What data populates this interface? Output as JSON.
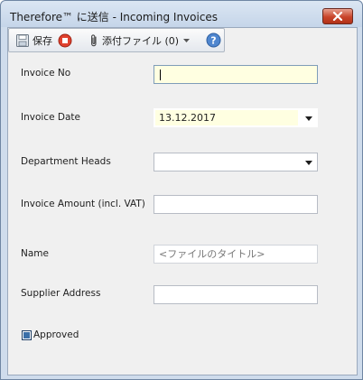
{
  "window": {
    "title": "Therefore™ に送信 - Incoming Invoices",
    "close_icon": "close-x-icon"
  },
  "toolbar": {
    "save_label": "保存",
    "save_icon": "floppy-disk-icon",
    "stop_icon": "stop-icon",
    "attach_label": "添付ファイル (0)",
    "attach_icon": "paperclip-icon",
    "help_icon": "help-icon"
  },
  "form": {
    "invoice_no": {
      "label": "Invoice No",
      "value": ""
    },
    "invoice_date": {
      "label": "Invoice Date",
      "value": "13.12.2017"
    },
    "department_heads": {
      "label": "Department Heads",
      "value": ""
    },
    "invoice_amount": {
      "label": "Invoice Amount (incl. VAT)",
      "value": ""
    },
    "name": {
      "label": "Name",
      "value": "",
      "placeholder": "<ファイルのタイトル>"
    },
    "supplier_address": {
      "label": "Supplier Address",
      "value": ""
    },
    "approved": {
      "label": "Approved",
      "checked": true
    }
  },
  "colors": {
    "active_field": "#ffffe1",
    "title_bar": "#c5d5e9",
    "close_button": "#c9452b",
    "checkbox_fill": "#3a6fa8"
  }
}
